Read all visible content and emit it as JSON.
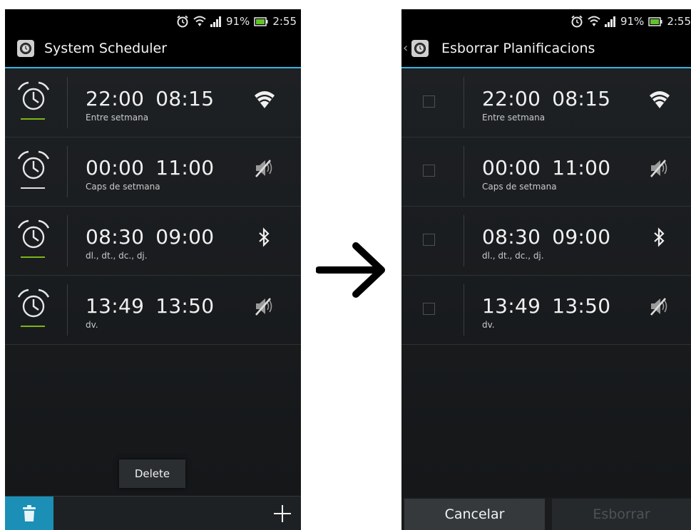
{
  "status": {
    "battery_percent": "91%",
    "time": "2:55"
  },
  "left": {
    "title": "System Scheduler",
    "popup_label": "Delete"
  },
  "right": {
    "title": "Esborrar Planificacions",
    "cancel_label": "Cancelar",
    "delete_label": "Esborrar"
  },
  "schedules": [
    {
      "start": "22:00",
      "end": "08:15",
      "days": "Entre setmana",
      "action_icon": "wifi-icon",
      "enabled": true
    },
    {
      "start": "00:00",
      "end": "11:00",
      "days": "Caps de setmana",
      "action_icon": "sound-off-icon",
      "enabled": false
    },
    {
      "start": "08:30",
      "end": "09:00",
      "days": "dl., dt., dc., dj.",
      "action_icon": "bluetooth-icon",
      "enabled": true
    },
    {
      "start": "13:49",
      "end": "13:50",
      "days": "dv.",
      "action_icon": "sound-off-icon",
      "enabled": true
    }
  ],
  "colors": {
    "accent": "#33b5e5",
    "enabled": "#7cb518",
    "disabled": "#e0e0e0",
    "trash_bg": "#1b8fb5"
  }
}
